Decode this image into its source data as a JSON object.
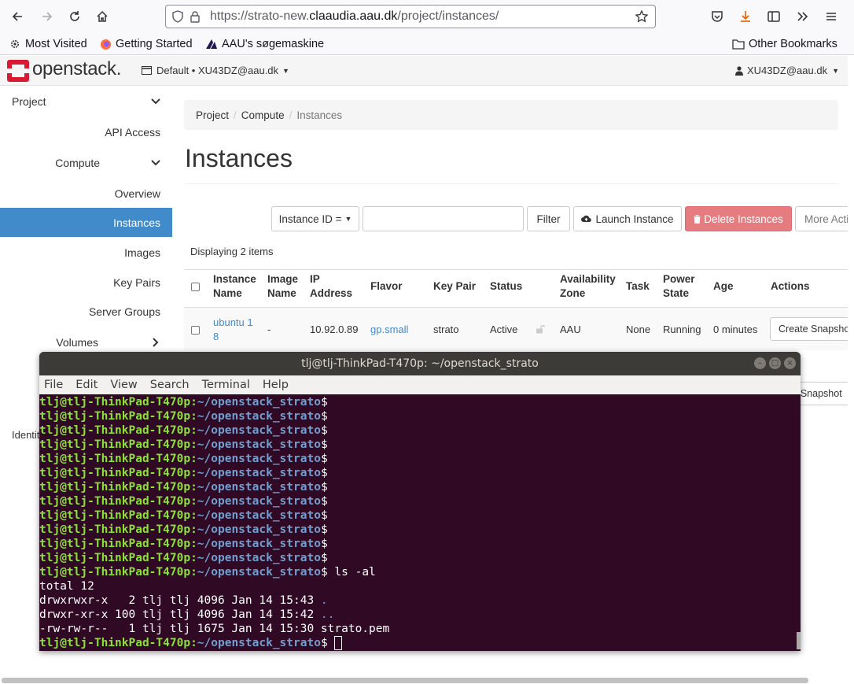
{
  "browser": {
    "url_prefix": "https://strato-new.",
    "url_domain": "claaudia.aau.dk",
    "url_path": "/project/instances/",
    "bookmarks": [
      "Most Visited",
      "Getting Started",
      "AAU's søgemaskine"
    ],
    "other_bookmarks": "Other Bookmarks"
  },
  "header": {
    "logo_text": "openstack.",
    "project_selector": "Default • XU43DZ@aau.dk",
    "user_menu": "XU43DZ@aau.dk",
    "brand_color": "#da1a32"
  },
  "sidebar": {
    "project": "Project",
    "api_access": "API Access",
    "compute": "Compute",
    "overview": "Overview",
    "instances": "Instances",
    "images": "Images",
    "key_pairs": "Key Pairs",
    "server_groups": "Server Groups",
    "volumes": "Volumes",
    "identity_partial": "Identit"
  },
  "breadcrumb": {
    "project": "Project",
    "compute": "Compute",
    "current": "Instances"
  },
  "page_title": "Instances",
  "actions": {
    "filter_select": "Instance ID =",
    "filter_button": "Filter",
    "launch": "Launch Instance",
    "delete": "Delete Instances",
    "more": "More Actio"
  },
  "table": {
    "displaying": "Displaying 2 items",
    "headers": {
      "instance_name": [
        "Instance",
        "Name"
      ],
      "image_name": [
        "Image",
        "Name"
      ],
      "ip_address": [
        "IP",
        "Address"
      ],
      "flavor": "Flavor",
      "key_pair": "Key Pair",
      "status": "Status",
      "availability_zone": [
        "Availability",
        "Zone"
      ],
      "task": "Task",
      "power_state": [
        "Power",
        "State"
      ],
      "age": "Age",
      "actions": "Actions"
    },
    "row1": {
      "name": [
        "ubuntu 1",
        "8"
      ],
      "image": "-",
      "ip": "10.92.0.89",
      "flavor": "gp.small",
      "key_pair": "strato",
      "status": "Active",
      "zone": "AAU",
      "task": "None",
      "power": "Running",
      "age": "0 minutes",
      "action": "Create Snapshot"
    },
    "row2_action_partial": "ate Snapshot"
  },
  "terminal": {
    "title": "tlj@tlj-ThinkPad-T470p: ~/openstack_strato",
    "menu": [
      "File",
      "Edit",
      "View",
      "Search",
      "Terminal",
      "Help"
    ],
    "prompt_user": "tlj@tlj-ThinkPad-T470p",
    "prompt_path": "~/openstack_strato",
    "command": " ls -al",
    "output": [
      {
        "text": "total 12",
        "name": ""
      },
      {
        "text": "drwxrwxr-x   2 tlj tlj 4096 Jan 14 15:43 ",
        "name": "."
      },
      {
        "text": "drwxr-xr-x 100 tlj tlj 4096 Jan 14 15:42 ",
        "name": ".."
      },
      {
        "text": "-rw-rw-r--   1 tlj tlj 1675 Jan 14 15:30 strato.pem",
        "name": ""
      }
    ]
  }
}
